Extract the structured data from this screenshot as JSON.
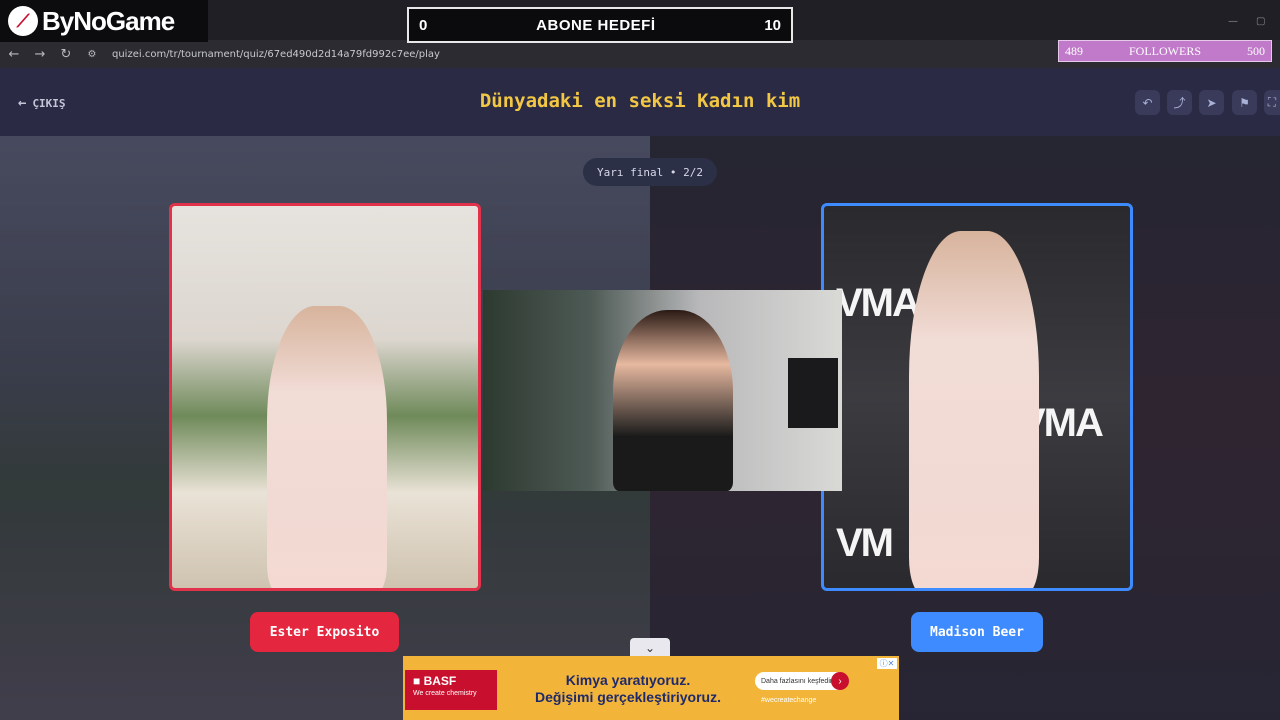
{
  "browser": {
    "url": "quizei.com/tr/tournament/quiz/67ed490d2d14a79fd992c7ee/play",
    "back_icon": "arrow-left-icon",
    "forward_icon": "arrow-right-icon",
    "reload_icon": "reload-icon"
  },
  "overlay": {
    "brand_name": "ByNoGame",
    "goal_min": "0",
    "goal_title": "ABONE HEDEFİ",
    "goal_max": "10",
    "followers_current": "489",
    "followers_label": "FOLLOWERS",
    "followers_target": "500"
  },
  "header": {
    "exit_label": "ÇIKIŞ",
    "title": "Dünyadaki en seksi Kadın kim",
    "buttons": [
      "undo-icon",
      "share-icon",
      "send-icon",
      "flag-icon",
      "fullscreen-icon"
    ]
  },
  "match": {
    "round": "Yarı final • 2/2",
    "left_name": "Ester Exposito",
    "right_name": "Madison Beer"
  },
  "ad": {
    "brand": "■ BASF",
    "brand_sub": "We create chemistry",
    "line1": "Kimya yaratıyoruz.",
    "line2": "Değişimi gerçekleştiriyoruz.",
    "cta": "Daha fazlasını keşfedin",
    "hashtag": "#wecreatechange"
  },
  "colors": {
    "accent_title": "#f2c744",
    "left_accent": "#e5263f",
    "right_accent": "#3d8bff"
  }
}
